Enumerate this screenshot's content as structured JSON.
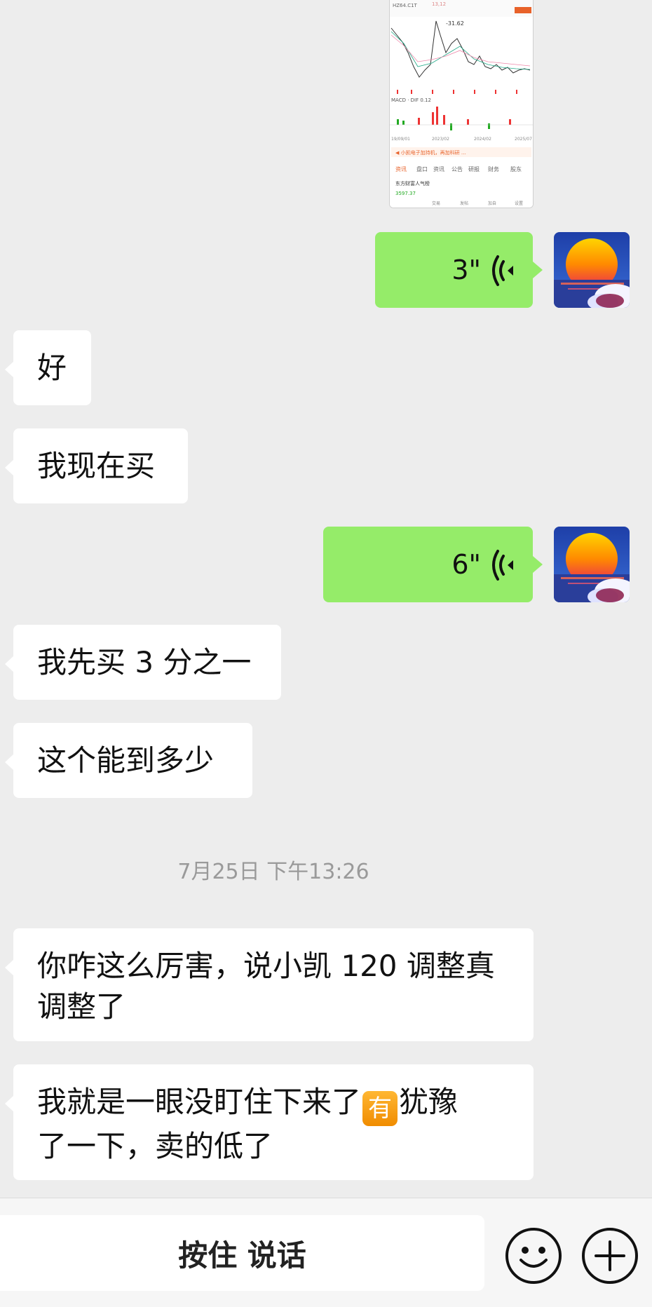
{
  "messages": {
    "voice_1": {
      "duration": "3\""
    },
    "voice_2": {
      "duration": "6\""
    },
    "recv_1": "好",
    "recv_2": "我现在买",
    "recv_3": "我先买 3 分之一",
    "recv_4": "这个能到多少",
    "timestamp": "7月25日 下午13:26",
    "recv_5_line1": "你咋这么厉害，说小凯 120 调整真",
    "recv_5_line2": "调整了",
    "recv_6_line1_a": "我就是一眼没盯住下来了",
    "recv_6_emoji": "有",
    "recv_6_line1_b": "犹豫",
    "recv_6_line2": "了一下，卖的低了"
  },
  "input_bar": {
    "hold_to_talk": "按住 说话",
    "emoji_button_icon": "smiley-icon",
    "more_button_icon": "plus-icon"
  },
  "colors": {
    "background": "#ededed",
    "sent_bubble": "#95ec69",
    "received_bubble": "#ffffff",
    "timestamp_text": "#9a9a9a"
  }
}
